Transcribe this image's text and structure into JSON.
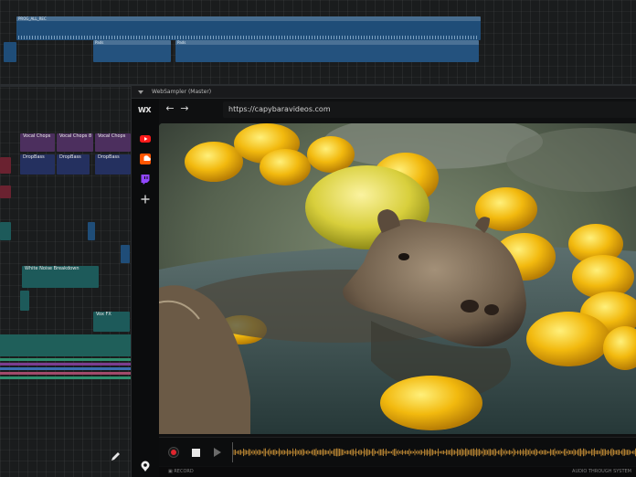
{
  "daw": {
    "top_clip_label": "PROG_ALL_REC",
    "clip_row2_label": "Pads",
    "clip_vocal_1": "Vocal Chops",
    "clip_vocal_2": "Vocal Chops 8",
    "clip_vocal_3": "Vocal Chops",
    "clip_drop_1": "DropBass",
    "clip_drop_2": "DropBass",
    "clip_drop_3": "DropBass",
    "clip_noise": "White Noise Breakdown",
    "clip_fx": "Vox FX"
  },
  "plugin": {
    "title": "WebSampler (Master)",
    "logo": "WX",
    "url": "https://capybaravideos.com",
    "progress": 0.78,
    "bottom_left": "▣ RECORD",
    "bottom_right": "AUDIO THROUGH SYSTEM"
  },
  "icons": {
    "youtube": "youtube-icon",
    "soundcloud": "soundcloud-icon",
    "twitch": "twitch-icon",
    "add": "plus-icon",
    "back": "arrow-left-icon",
    "forward": "arrow-right-icon",
    "pause": "pause-icon",
    "next": "skip-next-icon",
    "volume": "volume-icon",
    "record": "record-icon",
    "stop": "stop-icon",
    "play": "play-icon",
    "location": "location-pin-icon",
    "pencil": "pencil-icon"
  },
  "colors": {
    "accent_red": "#e31b23",
    "waveform": "#d69a3a",
    "daw_clip_blue": "#1f4d78"
  }
}
